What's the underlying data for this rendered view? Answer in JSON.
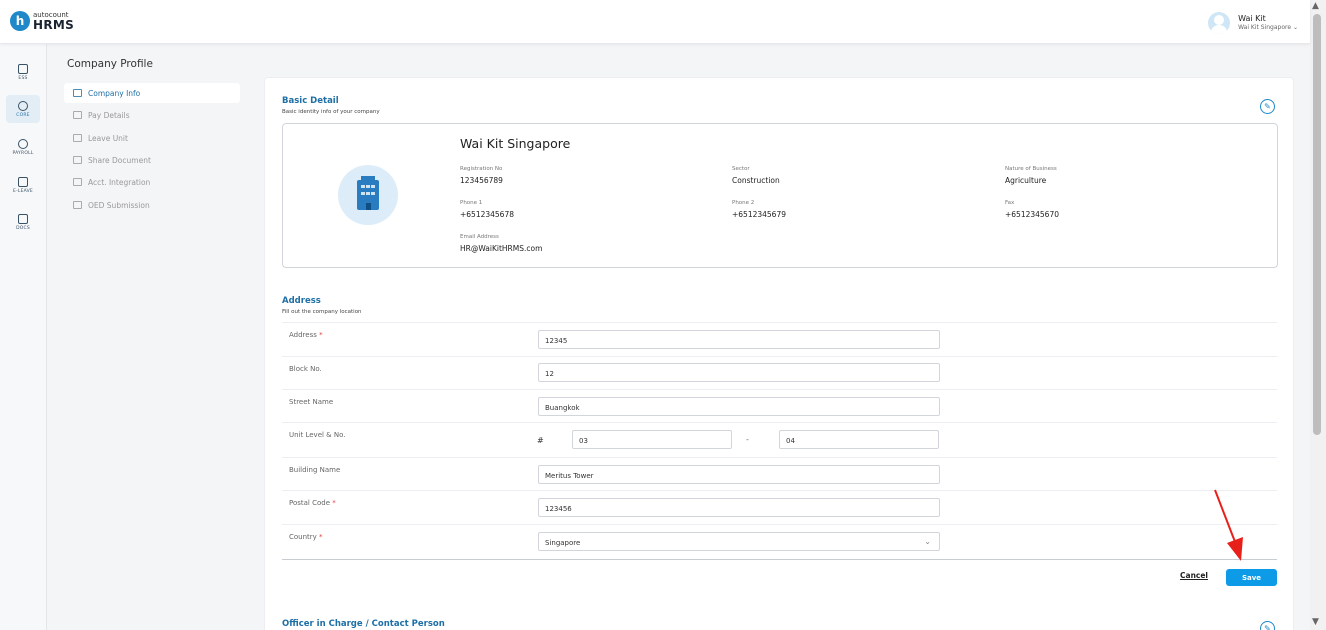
{
  "header": {
    "logo_small": "autocount",
    "logo_big": "HRMS",
    "user_name": "Wai Kit",
    "user_company": "Wai Kit Singapore"
  },
  "rail": [
    {
      "label": "ESS",
      "icon": "ess-icon"
    },
    {
      "label": "CORE",
      "icon": "core-icon"
    },
    {
      "label": "PAYROLL",
      "icon": "payroll-icon"
    },
    {
      "label": "E-LEAVE",
      "icon": "calendar-icon"
    },
    {
      "label": "DOCS",
      "icon": "docs-icon"
    }
  ],
  "subnav": {
    "title": "Company Profile",
    "items": [
      {
        "label": "Company Info",
        "active": true
      },
      {
        "label": "Pay Details"
      },
      {
        "label": "Leave Unit"
      },
      {
        "label": "Share Document"
      },
      {
        "label": "Acct. Integration"
      },
      {
        "label": "OED Submission"
      }
    ]
  },
  "basic": {
    "title": "Basic Detail",
    "subtitle": "Basic identity info of your company",
    "company_name": "Wai Kit Singapore",
    "fields": {
      "reg_label": "Registration No",
      "reg_value": "123456789",
      "sector_label": "Sector",
      "sector_value": "Construction",
      "nature_label": "Nature of Business",
      "nature_value": "Agriculture",
      "phone1_label": "Phone 1",
      "phone1_value": "+6512345678",
      "phone2_label": "Phone 2",
      "phone2_value": "+6512345679",
      "fax_label": "Fax",
      "fax_value": "+6512345670",
      "email_label": "Email Address",
      "email_value": "HR@WaiKitHRMS.com"
    }
  },
  "address": {
    "title": "Address",
    "subtitle": "Fill out the company location",
    "address_label": "Address",
    "address_value": "12345",
    "block_label": "Block No.",
    "block_value": "12",
    "street_label": "Street Name",
    "street_value": "Buangkok",
    "unit_label": "Unit Level & No.",
    "unit_hash": "#",
    "unit_level": "03",
    "unit_dash": "-",
    "unit_no": "04",
    "building_label": "Building Name",
    "building_value": "Meritus Tower",
    "postal_label": "Postal Code",
    "postal_value": "123456",
    "country_label": "Country",
    "country_value": "Singapore",
    "required_mark": "*"
  },
  "actions": {
    "cancel": "Cancel",
    "save": "Save"
  },
  "officer": {
    "title": "Officer in Charge / Contact Person"
  },
  "colors": {
    "accent": "#1e6fa6",
    "button": "#0d9be8",
    "annotation": "#e8201a"
  }
}
